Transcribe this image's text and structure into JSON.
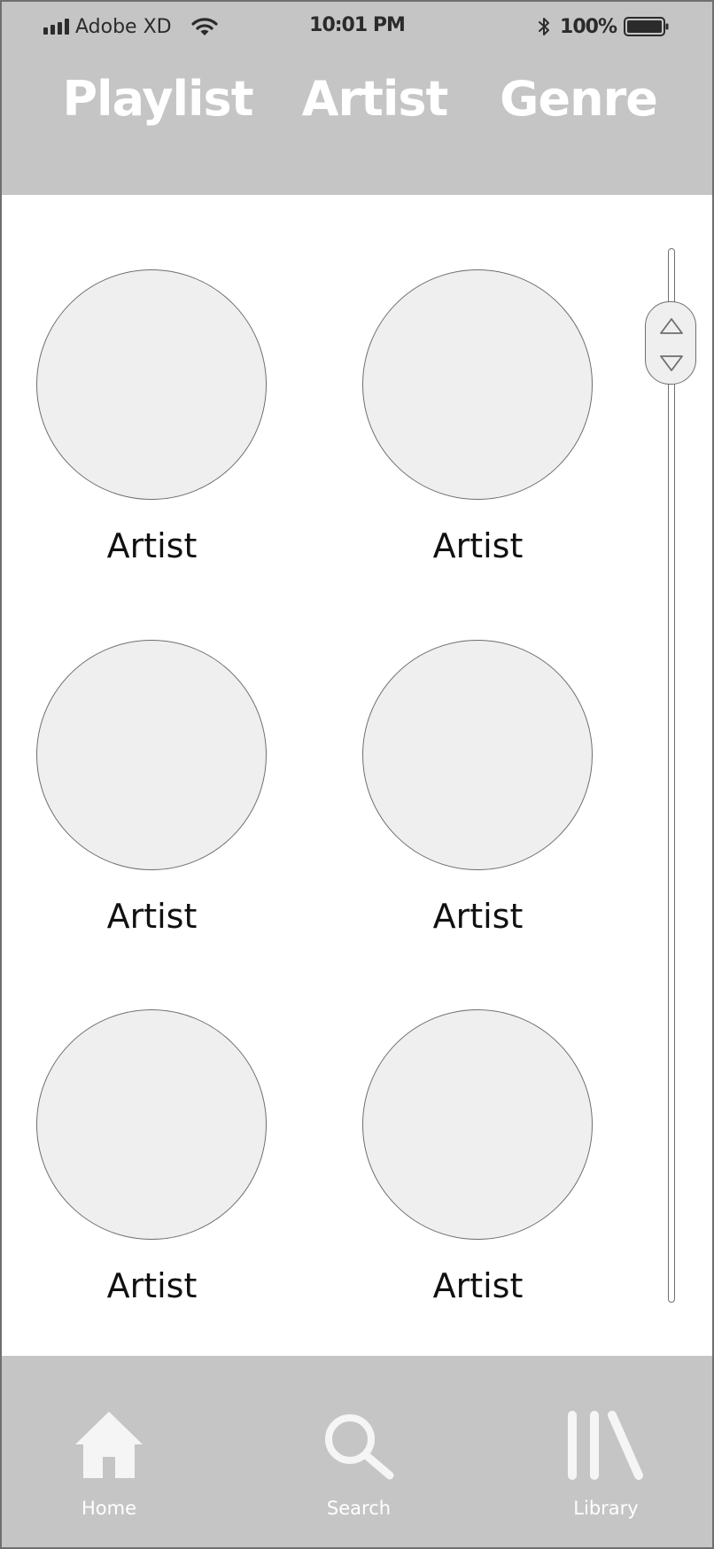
{
  "status_bar": {
    "carrier": "Adobe XD",
    "time": "10:01 PM",
    "battery": "100%",
    "icons": [
      "signal-icon",
      "wifi-icon",
      "bluetooth-icon",
      "battery-icon"
    ]
  },
  "top_tabs": [
    {
      "label": "Playlist"
    },
    {
      "label": "Artist"
    },
    {
      "label": "Genre"
    }
  ],
  "artists": [
    {
      "name": "Artist"
    },
    {
      "name": "Artist"
    },
    {
      "name": "Artist"
    },
    {
      "name": "Artist"
    },
    {
      "name": "Artist"
    },
    {
      "name": "Artist"
    }
  ],
  "scrollbar": {
    "icons": [
      "scroll-up-icon",
      "scroll-down-icon"
    ]
  },
  "bottom_nav": [
    {
      "label": "Home",
      "icon": "home-icon"
    },
    {
      "label": "Search",
      "icon": "search-icon"
    },
    {
      "label": "Library",
      "icon": "library-icon"
    }
  ],
  "colors": {
    "bar_background": "#c6c5c6",
    "placeholder_fill": "#efefef",
    "outline": "#6f6f6f",
    "tab_text": "#ffffff",
    "body_text": "#111111"
  }
}
